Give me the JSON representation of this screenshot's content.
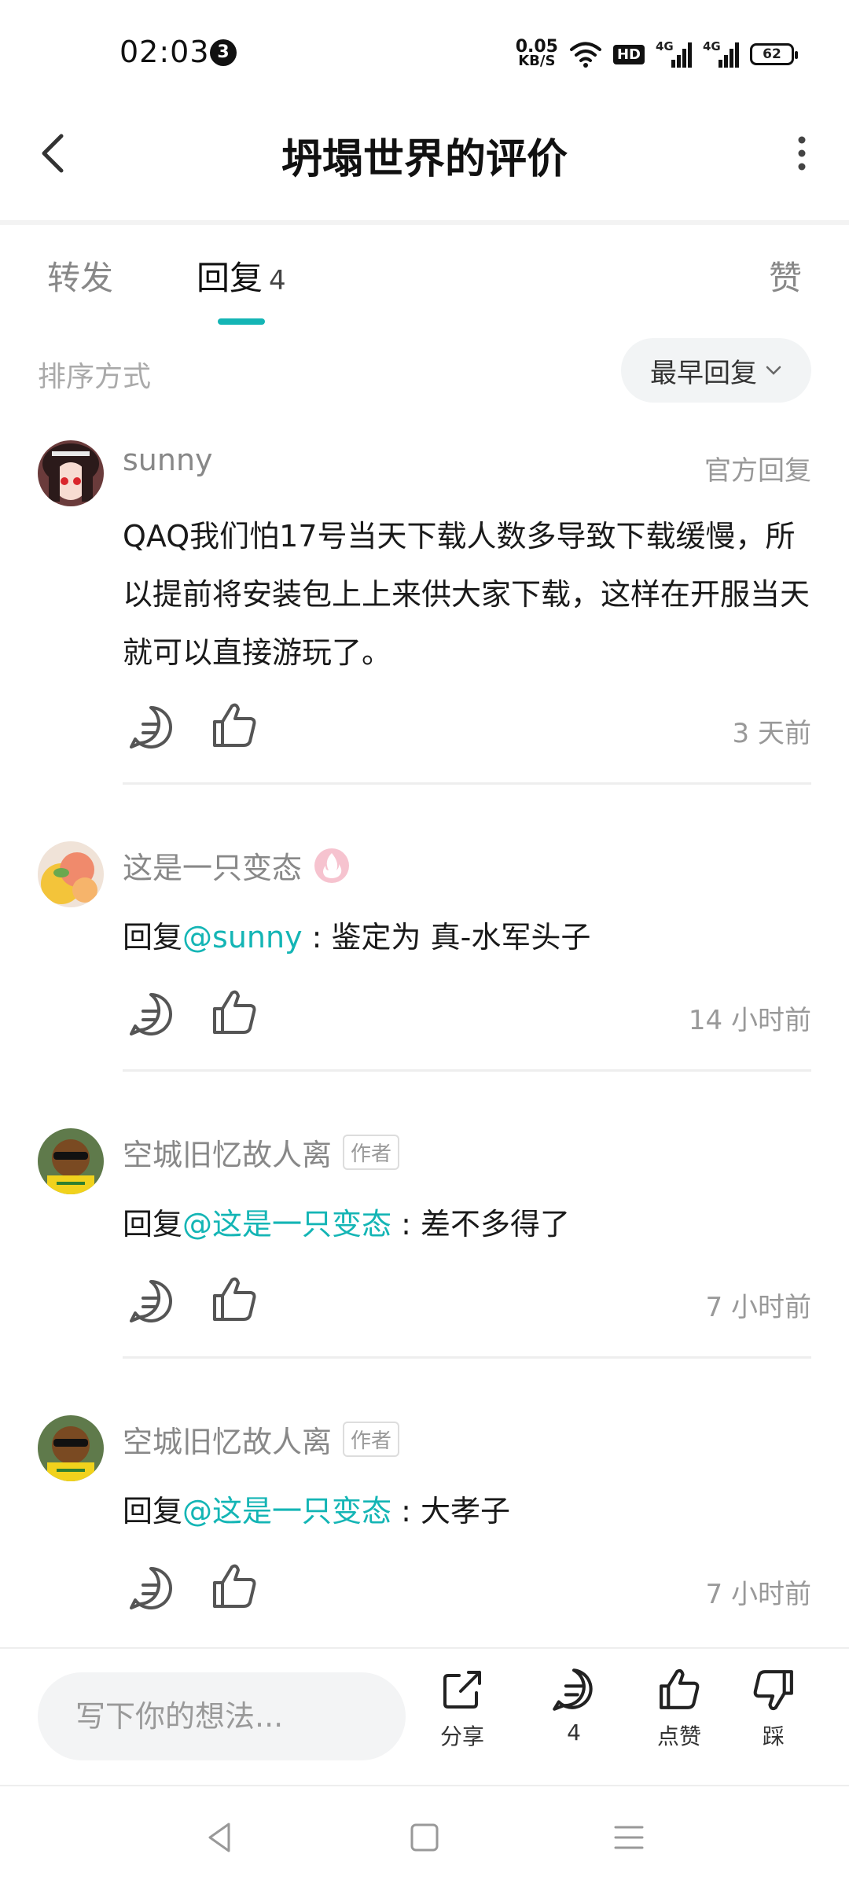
{
  "status_bar": {
    "time": "02:03",
    "notif_count": "3",
    "net_speed": "0.05",
    "net_unit": "KB/S",
    "hd": "HD",
    "sig1": "4G",
    "sig2": "4G",
    "battery": "62"
  },
  "header": {
    "title": "坍塌世界的评价"
  },
  "tabs": [
    {
      "label": "转发"
    },
    {
      "label": "回复",
      "count": "4"
    },
    {
      "label": "赞"
    }
  ],
  "sort": {
    "label": "排序方式",
    "value": "最早回复"
  },
  "comments": [
    {
      "name": "sunny",
      "badge": "官方回复",
      "text": "QAQ我们怕17号当天下载人数多导致下载缓慢，所以提前将安装包上上来供大家下载，这样在开服当天就可以直接游玩了。",
      "time": "3 天前"
    },
    {
      "name": "这是一只变态",
      "reply_prefix": "回复",
      "mention": "@sunny",
      "text": " : 鉴定为 真-水军头子",
      "time": "14 小时前"
    },
    {
      "name": "空城旧忆故人离",
      "tag": "作者",
      "reply_prefix": "回复",
      "mention": "@这是一只变态",
      "text": " : 差不多得了",
      "time": "7 小时前"
    },
    {
      "name": "空城旧忆故人离",
      "tag": "作者",
      "reply_prefix": "回复",
      "mention": "@这是一只变态",
      "text": " : 大孝子",
      "time": "7 小时前"
    }
  ],
  "bottom_bar": {
    "input_placeholder": "写下你的想法...",
    "share_label": "分享",
    "comment_count": "4",
    "like_label": "点赞",
    "dislike_label": "踩"
  },
  "colors": {
    "accent": "#14b5b5"
  }
}
